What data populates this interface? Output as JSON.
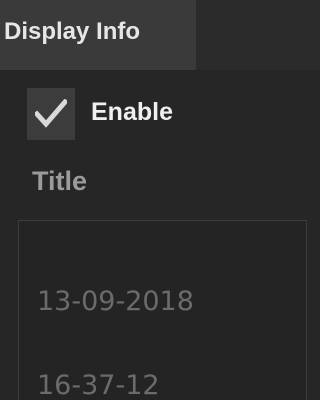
{
  "panel": {
    "tab_label": "Display Info"
  },
  "enable": {
    "label": "Enable",
    "checked": true
  },
  "title_field": {
    "label": "Title",
    "lines": [
      "13-09-2018",
      "16-37-12"
    ]
  },
  "icons": {
    "checkbox": "checkmark-icon"
  },
  "colors": {
    "background": "#262626",
    "tab": "#3a3a3a",
    "checkmark": "#d9d9d9"
  }
}
